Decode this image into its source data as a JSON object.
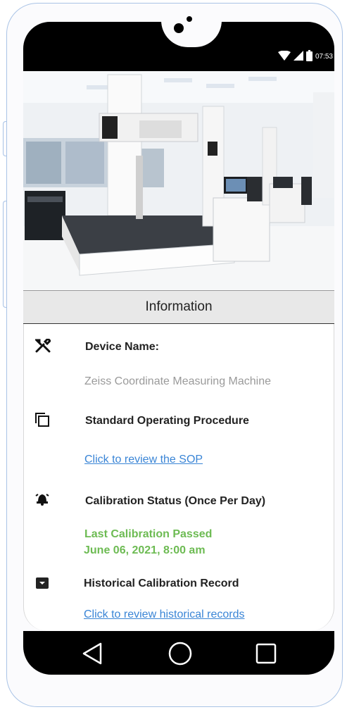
{
  "status_bar": {
    "time": "07:53",
    "icons": [
      "wifi-icon",
      "signal-icon",
      "battery-icon"
    ]
  },
  "hero": {
    "alt": "Zeiss Coordinate Measuring Machine lab"
  },
  "section_header": "Information",
  "device": {
    "label": "Device Name:",
    "value": "Zeiss Coordinate Measuring Machine",
    "icon": "tools-icon"
  },
  "sop": {
    "label": "Standard Operating Procedure",
    "link": "Click to review the SOP",
    "icon": "copy-icon"
  },
  "calibration": {
    "label": "Calibration Status (Once Per Day)",
    "status": "Last Calibration Passed",
    "date": "June 06, 2021, 8:00 am",
    "icon": "bell-icon"
  },
  "history": {
    "label": "Historical Calibration Record",
    "link": "Click to review historical records",
    "icon": "archive-icon"
  },
  "nav": {
    "items": [
      "back-icon",
      "home-icon",
      "recents-icon"
    ]
  },
  "colors": {
    "link": "#3a85d6",
    "success": "#6dbb53",
    "muted": "#9a9a9a",
    "phone_frame": "#a9c3e6"
  }
}
